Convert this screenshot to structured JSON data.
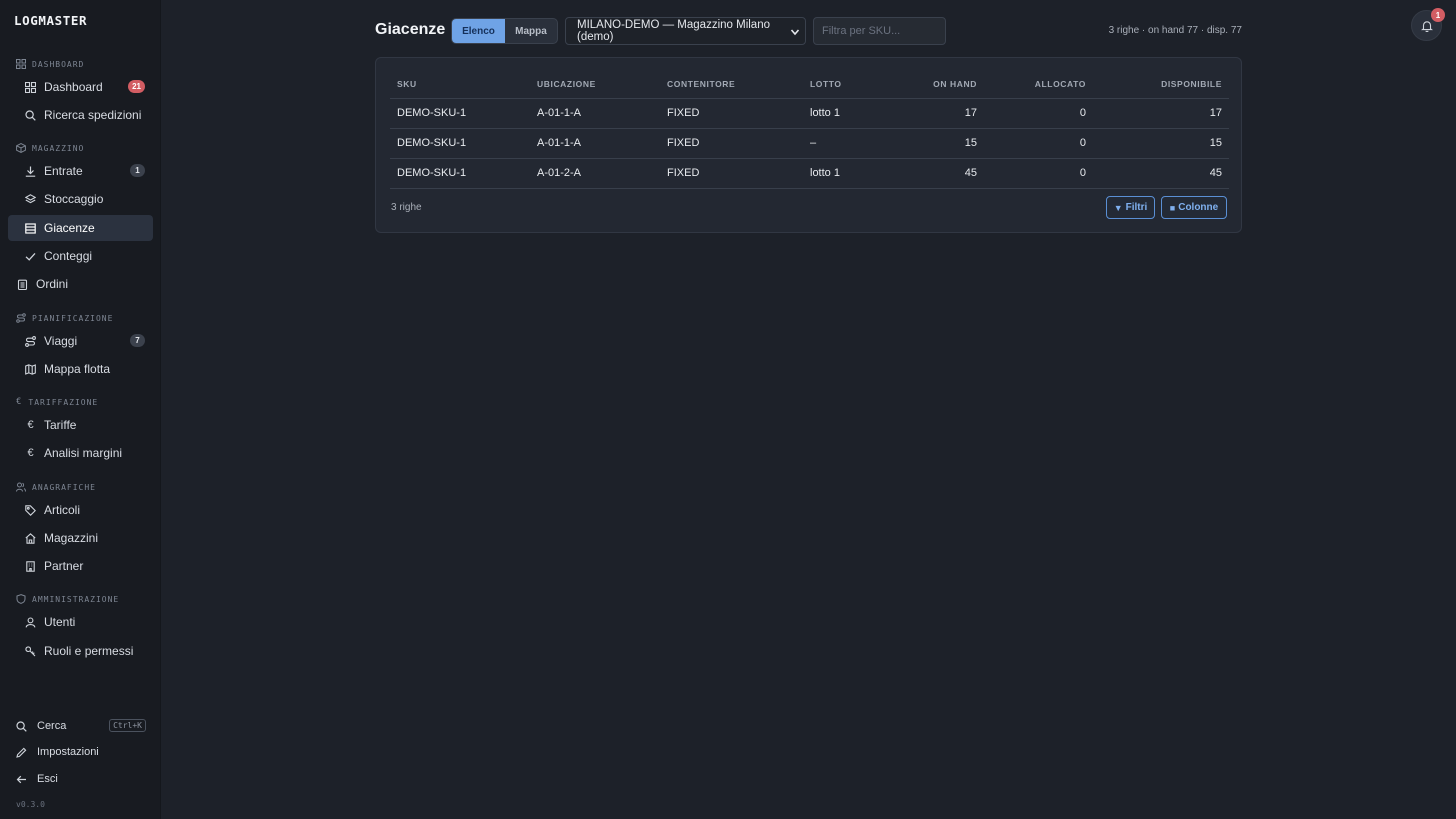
{
  "app": {
    "logo": "LOGMASTER",
    "version": "v0.3.0"
  },
  "sidebar": {
    "sections": {
      "dashboard": "DASHBOARD",
      "magazzino": "MAGAZZINO",
      "pianificazione": "PIANIFICAZIONE",
      "tariffazione": "TARIFFAZIONE",
      "anagrafiche": "ANAGRAFICHE",
      "amministrazione": "AMMINISTRAZIONE"
    },
    "items": {
      "dashboard": {
        "label": "Dashboard",
        "badge": "21",
        "icon": "grid-icon"
      },
      "ricerca": {
        "label": "Ricerca spedizioni",
        "icon": "search-icon"
      },
      "entrate": {
        "label": "Entrate",
        "badge": "1",
        "icon": "download-icon"
      },
      "stoccaggio": {
        "label": "Stoccaggio",
        "icon": "layers-icon"
      },
      "giacenze": {
        "label": "Giacenze",
        "icon": "archive-icon",
        "active": true
      },
      "conteggi": {
        "label": "Conteggi",
        "icon": "check-icon"
      },
      "ordini": {
        "label": "Ordini",
        "icon": "clipboard-icon"
      },
      "viaggi": {
        "label": "Viaggi",
        "badge": "7",
        "icon": "route-icon"
      },
      "mappa_flotta": {
        "label": "Mappa flotta",
        "icon": "map-icon"
      },
      "tariffe": {
        "label": "Tariffe",
        "icon": "euro-icon"
      },
      "analisi_margini": {
        "label": "Analisi margini",
        "icon": "euro-icon"
      },
      "articoli": {
        "label": "Articoli",
        "icon": "tag-icon"
      },
      "magazzini": {
        "label": "Magazzini",
        "icon": "home-icon"
      },
      "partner": {
        "label": "Partner",
        "icon": "building-icon"
      },
      "utenti": {
        "label": "Utenti",
        "icon": "user-icon"
      },
      "ruoli": {
        "label": "Ruoli e permessi",
        "icon": "key-icon"
      }
    },
    "bottom": {
      "cerca": "Cerca",
      "cerca_shortcut": "Ctrl+K",
      "impostazioni": "Impostazioni",
      "esci": "Esci"
    }
  },
  "header": {
    "title": "Giacenze",
    "view_toggle": {
      "list": "Elenco",
      "map": "Mappa",
      "selected": "Elenco"
    },
    "warehouse_select": "MILANO-DEMO — Magazzino Milano (demo)",
    "sku_filter_placeholder": "Filtra per SKU...",
    "summary": "3 righe · on hand 77 · disp. 77",
    "notifications_count": "1"
  },
  "table": {
    "columns": [
      "SKU",
      "UBICAZIONE",
      "CONTENITORE",
      "LOTTO",
      "ON HAND",
      "ALLOCATO",
      "DISPONIBILE"
    ],
    "rows": [
      [
        "DEMO-SKU-1",
        "A-01-1-A",
        "FIXED",
        "lotto 1",
        "17",
        "0",
        "17"
      ],
      [
        "DEMO-SKU-1",
        "A-01-1-A",
        "FIXED",
        "–",
        "15",
        "0",
        "15"
      ],
      [
        "DEMO-SKU-1",
        "A-01-2-A",
        "FIXED",
        "lotto 1",
        "45",
        "0",
        "45"
      ]
    ],
    "row_count": "3 righe",
    "filters_button": "Filtri",
    "columns_button": "Colonne"
  },
  "colors": {
    "accent": "#6fa3e6",
    "badge_red": "#d25d63",
    "background": "#1d2129",
    "sidebar": "#181b21"
  }
}
